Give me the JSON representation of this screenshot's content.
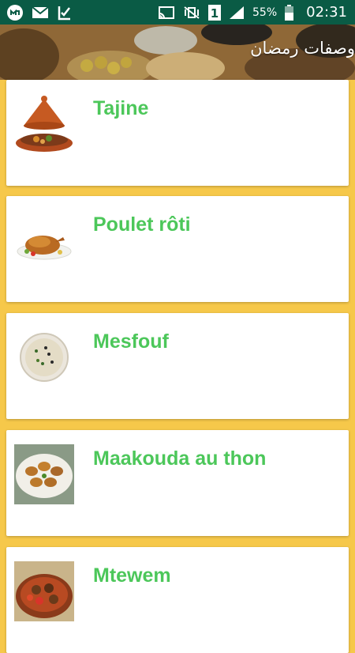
{
  "status_bar": {
    "battery": "55%",
    "time": "02:31",
    "sim_slot": "1"
  },
  "app": {
    "title": "وصفات رمضان"
  },
  "recipes": [
    {
      "name": "Tajine"
    },
    {
      "name": "Poulet rôti"
    },
    {
      "name": "Mesfouf"
    },
    {
      "name": "Maakouda au thon"
    },
    {
      "name": "Mtewem"
    }
  ],
  "colors": {
    "status_bar": "#0a5b45",
    "page_background": "#f6c84a",
    "recipe_title": "#4cc75a"
  }
}
